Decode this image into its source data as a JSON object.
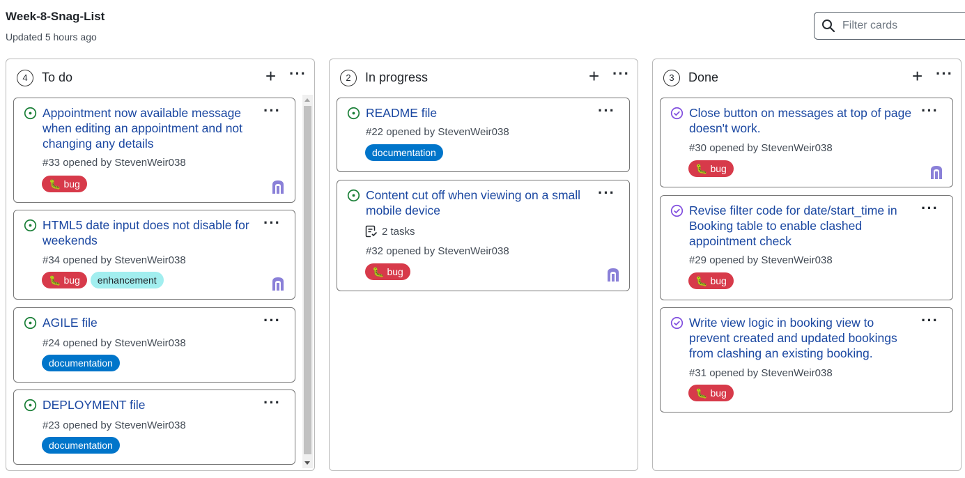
{
  "board": {
    "title": "Week-8-Snag-List",
    "updated": "Updated 5 hours ago"
  },
  "filter": {
    "placeholder": "Filter cards"
  },
  "columns": [
    {
      "count": "4",
      "name": "To do",
      "cards": [
        {
          "title_lines": [
            "Appointment now available message",
            "when editing an appointment and not",
            "changing any details"
          ],
          "meta": "#33 opened by StevenWeir038",
          "labels": [
            "bug"
          ]
        },
        {
          "title_lines": [
            "HTML5 date input does not disable for",
            "weekends"
          ],
          "meta": "#34 opened by StevenWeir038",
          "labels": [
            "bug",
            "enhancement"
          ]
        },
        {
          "title_lines": [
            "AGILE file"
          ],
          "meta": "#24 opened by StevenWeir038",
          "labels": [
            "documentation"
          ]
        },
        {
          "title_lines": [
            "DEPLOYMENT file"
          ],
          "meta": "#23 opened by StevenWeir038",
          "labels": [
            "documentation"
          ]
        }
      ]
    },
    {
      "count": "2",
      "name": "In progress",
      "cards": [
        {
          "title_lines": [
            "README file"
          ],
          "meta": "#22 opened by StevenWeir038",
          "labels": [
            "documentation"
          ]
        },
        {
          "title_lines": [
            "Content cut off when viewing on a small",
            "mobile device"
          ],
          "tasks": "2 tasks",
          "meta": "#32 opened by StevenWeir038",
          "labels": [
            "bug"
          ]
        }
      ]
    },
    {
      "count": "3",
      "name": "Done",
      "cards": [
        {
          "title_lines": [
            "Close button on messages at top of page",
            "doesn't work."
          ],
          "meta": "#30 opened by StevenWeir038",
          "labels": [
            "bug"
          ]
        },
        {
          "title_lines": [
            "Revise filter code for date/start_time in",
            "Booking table to enable clashed",
            "appointment check"
          ],
          "meta": "#29 opened by StevenWeir038",
          "labels": [
            "bug"
          ]
        },
        {
          "title_lines": [
            "Write view logic in booking view to",
            "prevent created and updated bookings",
            "from clashing an existing booking."
          ],
          "meta": "#31 opened by StevenWeir038",
          "labels": [
            "bug"
          ]
        }
      ]
    }
  ],
  "label_names": {
    "bug": "bug",
    "enhancement": "enhancement",
    "documentation": "documentation"
  },
  "colors": {
    "open_issue": "#1a7f37",
    "closed_issue": "#8250df",
    "bug": "#d73a4a",
    "documentation": "#0075ca",
    "enhancement": "#a2eeef",
    "link": "#1a47a1"
  },
  "icons": {
    "search": "search-icon",
    "open_issue": "issue-opened-icon",
    "closed_issue": "issue-closed-icon",
    "tasks": "tasklist-icon",
    "bug_emoji": "🐛",
    "add": "+",
    "menu": "···"
  }
}
